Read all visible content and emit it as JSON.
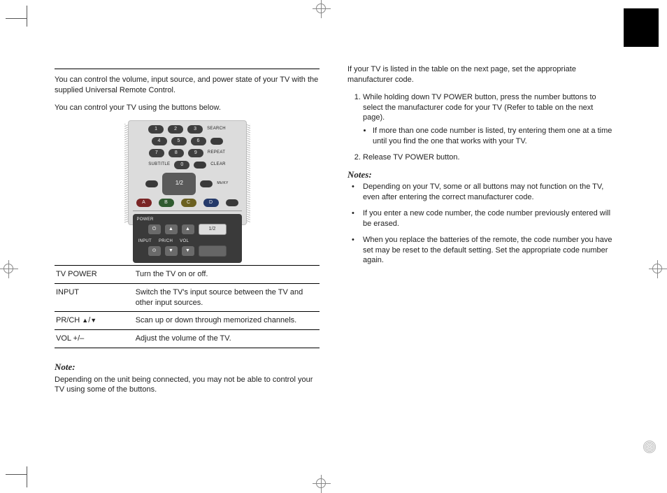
{
  "left": {
    "intro1": "You can control the volume, input source, and power state of your  TV with the supplied Universal Remote Control.",
    "intro2": "You can control your TV using the buttons below.",
    "remote": {
      "nums": [
        "1",
        "2",
        "3",
        "4",
        "5",
        "6",
        "7",
        "8",
        "9",
        "0"
      ],
      "lbl_search": "SEARCH",
      "lbl_repeat": "REPEAT",
      "lbl_subtitle": "SUBTITLE",
      "lbl_clear": "CLEAR",
      "lbl_mkr": "Mk/KY",
      "abcd": [
        "A",
        "B",
        "C",
        "D"
      ],
      "lbl_power": "POWER",
      "dpad": "1/2",
      "lbl_input": "INPUT",
      "lbl_prch": "PR/CH",
      "lbl_vol": "VOL"
    },
    "table": [
      {
        "btn": "TV POWER",
        "desc": "Turn the TV on or off."
      },
      {
        "btn": "INPUT",
        "desc": "Switch the TV's input source between the TV and other input sources."
      },
      {
        "btn": "PR/CH ",
        "desc": "Scan up or down through memorized channels."
      },
      {
        "btn": "VOL +/–",
        "desc": "Adjust the volume of the TV."
      }
    ],
    "note_h": "Note:",
    "note_body": "Depending on the unit being connected, you may not be able to control your TV using some of the buttons."
  },
  "right": {
    "intro": "If your TV is listed in the table on the next page, set the appropriate manufacturer code.",
    "step1": "While holding down TV POWER button, press the number buttons to select the manufacturer code for your  TV (Refer to table on the next page).",
    "step1_sub": "If more than one code number is listed, try entering them one at a time until you find the one that works with your  TV.",
    "step2": "Release TV POWER button.",
    "notes_h": "Notes:",
    "n1": "Depending on your TV, some or all buttons may not function on the  TV, even after entering the correct manufacturer code.",
    "n2": "If you enter a new code number, the code number previously entered will be erased.",
    "n3": "When you replace the batteries of the remote, the code number you have set may be reset to the default setting. Set the appropriate code number again."
  }
}
